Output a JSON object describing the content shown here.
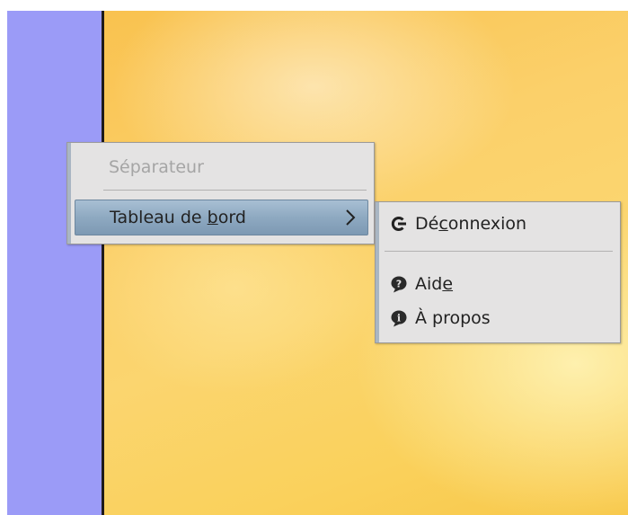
{
  "main_menu": {
    "separator_label": "Séparateur",
    "tableau": {
      "before": "Tableau de ",
      "mnemonic": "b",
      "after": "ord"
    }
  },
  "sub_menu": {
    "deconnexion": {
      "before": "Dé",
      "mnemonic": "c",
      "after": "onnexion",
      "icon": "logout-icon"
    },
    "aide": {
      "before": "Aid",
      "mnemonic": "e",
      "after": "",
      "icon": "help-bubble-icon"
    },
    "apropos": {
      "label": "À propos",
      "icon": "info-bubble-icon"
    }
  },
  "colors": {
    "panel": "#9b9bf7",
    "menu_bg": "#e4e3e3",
    "highlight": "#8ea9c1"
  }
}
